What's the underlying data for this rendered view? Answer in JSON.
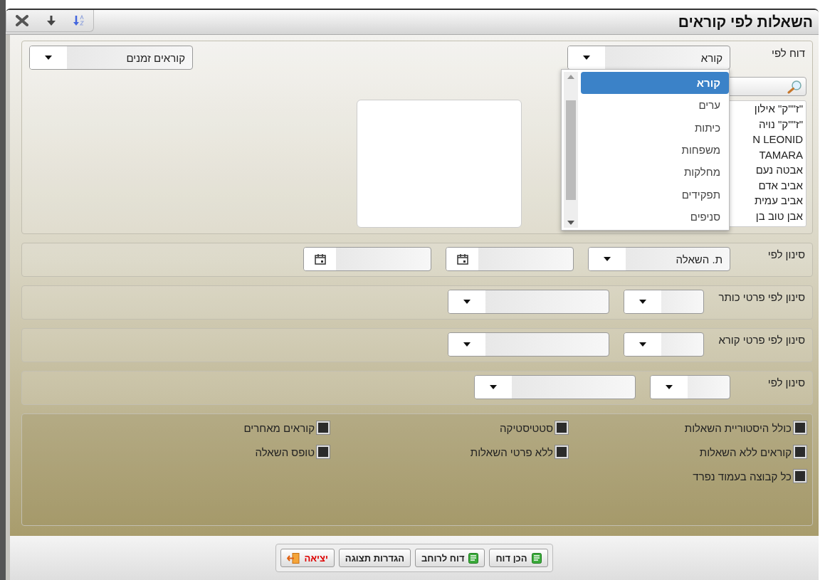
{
  "window": {
    "title": "השאלות לפי קוראים"
  },
  "toolbar": [
    {
      "kind": "close"
    },
    {
      "kind": "down"
    },
    {
      "kind": "sort"
    }
  ],
  "report_by": {
    "label": "דוח לפי",
    "value": "קורא",
    "expanded": true,
    "options": [
      {
        "label": "קורא",
        "selected": true
      },
      {
        "label": "ערים",
        "selected": false
      },
      {
        "label": "כיתות",
        "selected": false
      },
      {
        "label": "משפחות",
        "selected": false
      },
      {
        "label": "מחלקות",
        "selected": false
      },
      {
        "label": "תפקידים",
        "selected": false
      },
      {
        "label": "סניפים",
        "selected": false
      }
    ]
  },
  "readers_list": [
    "\"ז\"\"ק\" אילון",
    "\"ז\"\"ק\" נויה",
    "N LEONID",
    "TAMARA",
    "אבטה נעם",
    "אביב אדם",
    "אביב עמית",
    "אבן טוב בן"
  ],
  "reader_type": {
    "value": "קוראים זמנים"
  },
  "filters": [
    {
      "label": "סינון לפי",
      "controls": [
        {
          "kind": "select",
          "value": "ת. השאלה"
        },
        {
          "kind": "date"
        },
        {
          "kind": "date"
        }
      ]
    },
    {
      "label": "סינון לפי פרטי כותר",
      "controls": [
        {
          "kind": "small-select"
        },
        {
          "kind": "select"
        }
      ]
    },
    {
      "label": "סינון לפי פרטי קורא",
      "controls": [
        {
          "kind": "small-select"
        },
        {
          "kind": "select"
        }
      ]
    },
    {
      "label": "סינון לפי",
      "controls": [
        {
          "kind": "small-select"
        },
        {
          "kind": "select"
        }
      ]
    }
  ],
  "options": [
    {
      "label": "כולל היסטוריית השאלות",
      "checked": false
    },
    {
      "label": "סטטיסטיקה",
      "checked": false
    },
    {
      "label": "קוראים מאחרים",
      "checked": false
    },
    {
      "label": "קוראים ללא השאלות",
      "checked": false
    },
    {
      "label": "ללא פרטי השאלות",
      "checked": false
    },
    {
      "label": "טופס השאלה",
      "checked": false
    },
    {
      "label": "כל קבוצה בעמוד נפרד",
      "checked": false
    }
  ],
  "buttons": [
    {
      "label": "הכן דוח",
      "kind": "report"
    },
    {
      "label": "דוח לרוחב",
      "kind": "report"
    },
    {
      "label": "הגדרות תצוגה",
      "kind": "plain"
    },
    {
      "label": "יציאה",
      "kind": "exit"
    }
  ]
}
